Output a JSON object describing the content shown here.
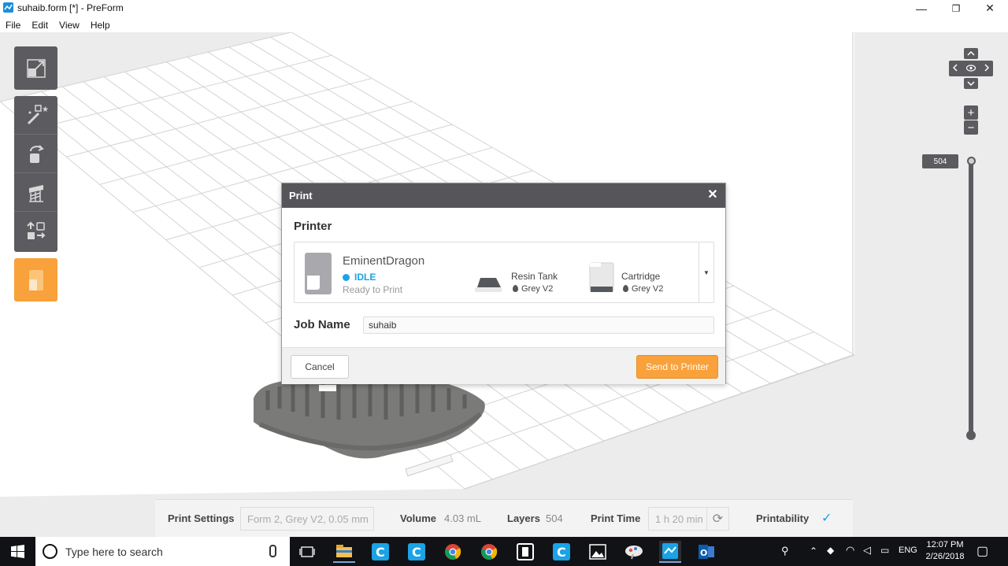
{
  "window": {
    "title": "suhaib.form [*] - PreForm",
    "minimize_glyph": "—",
    "restore_glyph": "❐",
    "close_glyph": "✕"
  },
  "menu": [
    "File",
    "Edit",
    "View",
    "Help"
  ],
  "left_toolbar": {
    "tools": [
      {
        "name": "model-view-icon",
        "active": false
      },
      {
        "name": "magic-wand-icon",
        "active": false
      },
      {
        "name": "orientation-icon",
        "active": false
      },
      {
        "name": "supports-icon",
        "active": false
      },
      {
        "name": "layout-icon",
        "active": false
      },
      {
        "name": "print-icon",
        "active": true
      }
    ]
  },
  "navigation": {
    "zoom_in": "+",
    "zoom_out": "−"
  },
  "layer_slider": {
    "value": "504"
  },
  "dialog": {
    "title": "Print",
    "close": "✕",
    "printer_section_label": "Printer",
    "printer": {
      "name": "EminentDragon",
      "status": "IDLE",
      "status_detail": "Ready to Print",
      "resin_tank_label": "Resin Tank",
      "resin_tank_material": "Grey V2",
      "cartridge_label": "Cartridge",
      "cartridge_material": "Grey V2",
      "dropdown_glyph": "▼"
    },
    "job_name_label": "Job Name",
    "job_name_value": "suhaib",
    "cancel_label": "Cancel",
    "send_label": "Send to Printer"
  },
  "status_bar": {
    "print_settings_label": "Print Settings",
    "print_settings_value": "Form 2, Grey V2, 0.05 mm",
    "volume_label": "Volume",
    "volume_value": "4.03 mL",
    "layers_label": "Layers",
    "layers_value": "504",
    "print_time_label": "Print Time",
    "print_time_value": "1 h 20 min",
    "printability_label": "Printability",
    "printability_glyph": "✓"
  },
  "taskbar": {
    "search_placeholder": "Type here to search",
    "language": "ENG",
    "time": "12:07 PM",
    "date": "2/26/2018"
  },
  "colors": {
    "accent_orange": "#f9a13a",
    "status_blue": "#1aa3e6",
    "panel_dark": "#5c5c60"
  }
}
